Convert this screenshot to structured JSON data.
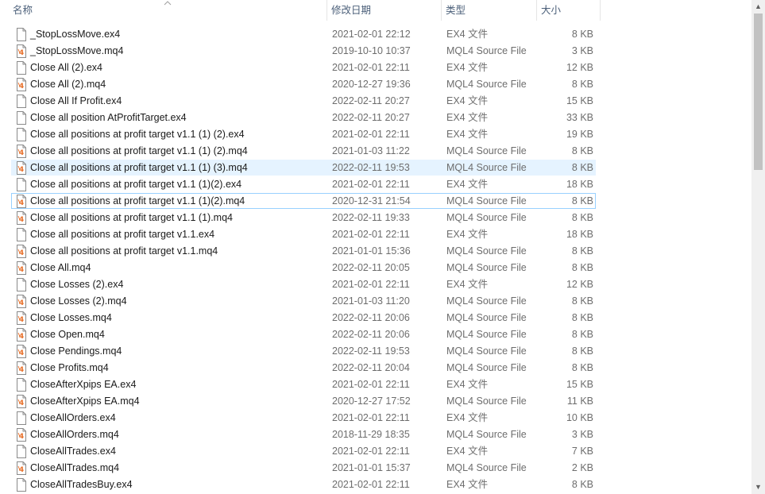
{
  "columns": {
    "name": "名称",
    "date": "修改日期",
    "type": "类型",
    "size": "大小"
  },
  "files": [
    {
      "name": "_StopLossMove.ex4",
      "date": "2021-02-01 22:12",
      "type": "EX4 文件",
      "size": "8 KB",
      "icon": "blank-file-icon"
    },
    {
      "name": "_StopLossMove.mq4",
      "date": "2019-10-10 10:37",
      "type": "MQL4 Source File",
      "size": "3 KB",
      "icon": "mq4-file-icon"
    },
    {
      "name": "Close All (2).ex4",
      "date": "2021-02-01 22:11",
      "type": "EX4 文件",
      "size": "12 KB",
      "icon": "blank-file-icon"
    },
    {
      "name": "Close All (2).mq4",
      "date": "2020-12-27 19:36",
      "type": "MQL4 Source File",
      "size": "8 KB",
      "icon": "mq4-file-icon"
    },
    {
      "name": "Close All If Profit.ex4",
      "date": "2022-02-11 20:27",
      "type": "EX4 文件",
      "size": "15 KB",
      "icon": "blank-file-icon"
    },
    {
      "name": "Close all position AtProfitTarget.ex4",
      "date": "2022-02-11 20:27",
      "type": "EX4 文件",
      "size": "33 KB",
      "icon": "blank-file-icon"
    },
    {
      "name": "Close all positions at profit target v1.1 (1) (2).ex4",
      "date": "2021-02-01 22:11",
      "type": "EX4 文件",
      "size": "19 KB",
      "icon": "blank-file-icon"
    },
    {
      "name": "Close all positions at profit target v1.1 (1) (2).mq4",
      "date": "2021-01-03 11:22",
      "type": "MQL4 Source File",
      "size": "8 KB",
      "icon": "mq4-file-icon"
    },
    {
      "name": "Close all positions at profit target v1.1 (1) (3).mq4",
      "date": "2022-02-11 19:53",
      "type": "MQL4 Source File",
      "size": "8 KB",
      "icon": "mq4-file-icon",
      "state": "selected"
    },
    {
      "name": "Close all positions at profit target v1.1 (1)(2).ex4",
      "date": "2021-02-01 22:11",
      "type": "EX4 文件",
      "size": "18 KB",
      "icon": "blank-file-icon"
    },
    {
      "name": "Close all positions at profit target v1.1 (1)(2).mq4",
      "date": "2020-12-31 21:54",
      "type": "MQL4 Source File",
      "size": "8 KB",
      "icon": "mq4-file-icon",
      "state": "focused"
    },
    {
      "name": "Close all positions at profit target v1.1 (1).mq4",
      "date": "2022-02-11 19:33",
      "type": "MQL4 Source File",
      "size": "8 KB",
      "icon": "mq4-file-icon"
    },
    {
      "name": "Close all positions at profit target v1.1.ex4",
      "date": "2021-02-01 22:11",
      "type": "EX4 文件",
      "size": "18 KB",
      "icon": "blank-file-icon"
    },
    {
      "name": "Close all positions at profit target v1.1.mq4",
      "date": "2021-01-01 15:36",
      "type": "MQL4 Source File",
      "size": "8 KB",
      "icon": "mq4-file-icon"
    },
    {
      "name": "Close All.mq4",
      "date": "2022-02-11 20:05",
      "type": "MQL4 Source File",
      "size": "8 KB",
      "icon": "mq4-file-icon"
    },
    {
      "name": "Close Losses (2).ex4",
      "date": "2021-02-01 22:11",
      "type": "EX4 文件",
      "size": "12 KB",
      "icon": "blank-file-icon"
    },
    {
      "name": "Close Losses (2).mq4",
      "date": "2021-01-03 11:20",
      "type": "MQL4 Source File",
      "size": "8 KB",
      "icon": "mq4-file-icon"
    },
    {
      "name": "Close Losses.mq4",
      "date": "2022-02-11 20:06",
      "type": "MQL4 Source File",
      "size": "8 KB",
      "icon": "mq4-file-icon"
    },
    {
      "name": "Close Open.mq4",
      "date": "2022-02-11 20:06",
      "type": "MQL4 Source File",
      "size": "8 KB",
      "icon": "mq4-file-icon"
    },
    {
      "name": "Close Pendings.mq4",
      "date": "2022-02-11 19:53",
      "type": "MQL4 Source File",
      "size": "8 KB",
      "icon": "mq4-file-icon"
    },
    {
      "name": "Close Profits.mq4",
      "date": "2022-02-11 20:04",
      "type": "MQL4 Source File",
      "size": "8 KB",
      "icon": "mq4-file-icon"
    },
    {
      "name": "CloseAfterXpips EA.ex4",
      "date": "2021-02-01 22:11",
      "type": "EX4 文件",
      "size": "15 KB",
      "icon": "blank-file-icon"
    },
    {
      "name": "CloseAfterXpips EA.mq4",
      "date": "2020-12-27 17:52",
      "type": "MQL4 Source File",
      "size": "11 KB",
      "icon": "mq4-file-icon"
    },
    {
      "name": "CloseAllOrders.ex4",
      "date": "2021-02-01 22:11",
      "type": "EX4 文件",
      "size": "10 KB",
      "icon": "blank-file-icon"
    },
    {
      "name": "CloseAllOrders.mq4",
      "date": "2018-11-29 18:35",
      "type": "MQL4 Source File",
      "size": "3 KB",
      "icon": "mq4-file-icon"
    },
    {
      "name": "CloseAllTrades.ex4",
      "date": "2021-02-01 22:11",
      "type": "EX4 文件",
      "size": "7 KB",
      "icon": "blank-file-icon"
    },
    {
      "name": "CloseAllTrades.mq4",
      "date": "2021-01-01 15:37",
      "type": "MQL4 Source File",
      "size": "2 KB",
      "icon": "mq4-file-icon"
    },
    {
      "name": "CloseAllTradesBuy.ex4",
      "date": "2021-02-01 22:11",
      "type": "EX4 文件",
      "size": "8 KB",
      "icon": "blank-file-icon"
    }
  ],
  "colors": {
    "header_text": "#4c607a",
    "selected_bg": "#e5f3ff",
    "focus_border": "#99d1ff",
    "mq4_icon_accent": "#e8702a"
  },
  "scrollbar": {
    "up_glyph": "▲",
    "down_glyph": "▼"
  }
}
